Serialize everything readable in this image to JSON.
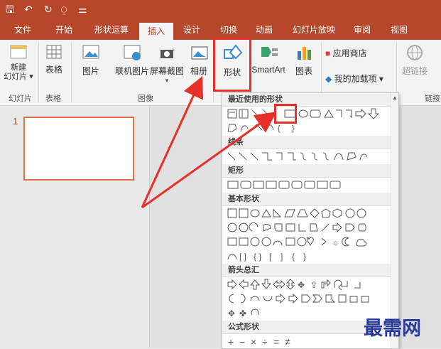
{
  "tabs": [
    "文件",
    "开始",
    "形状运算",
    "插入",
    "设计",
    "切换",
    "动画",
    "幻灯片放映",
    "审阅",
    "视图"
  ],
  "ribbon": {
    "new_slide": "新建\n幻灯片 ▾",
    "table": "表格",
    "picture": "图片",
    "online_picture": "联机图片",
    "screenshot": "屏幕截图",
    "album": "相册",
    "shapes": "形状",
    "smartart": "SmartArt",
    "chart": "图表",
    "app_store": "应用商店",
    "my_addins": "我的加载项 ▾",
    "hyperlink": "超链接",
    "group_slides": "幻灯片",
    "group_table": "表格",
    "group_image": "图像",
    "group_link": "链接"
  },
  "thumbnail_number": "1",
  "dropdown": {
    "recent": "最近使用的形状",
    "lines": "线条",
    "rect": "矩形",
    "basic": "基本形状",
    "arrows": "箭头总汇",
    "equation": "公式形状"
  },
  "watermark": "最需网"
}
